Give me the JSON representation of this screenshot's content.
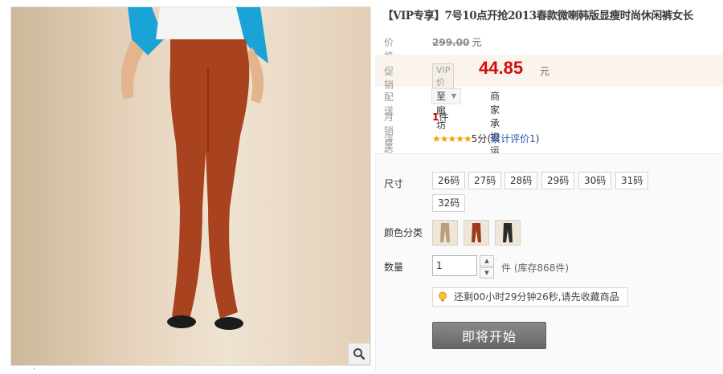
{
  "product": {
    "title": "【VIP专享】7号10点开抢2013春款微喇韩版显瘦时尚休闲裤女长"
  },
  "price": {
    "label": "价格",
    "original": "299.00",
    "unit": "元"
  },
  "promo": {
    "label": "促销",
    "tag": "VIP价格",
    "price": "44.85",
    "unit": "元"
  },
  "shipping": {
    "label": "配送",
    "region": "至 廊坊",
    "note": "商家承担运费"
  },
  "sales": {
    "label": "月销量",
    "count": "1",
    "unit": "件"
  },
  "rating": {
    "label": "评价",
    "stars": "★★★★★",
    "score": "5分",
    "open_paren": "(",
    "link": "累计评价1",
    "close_paren": ")"
  },
  "options": {
    "size_label": "尺寸",
    "sizes": [
      "26码",
      "27码",
      "28码",
      "29码",
      "30码",
      "31码",
      "32码"
    ],
    "color_label": "颜色分类",
    "colors": [
      {
        "name": "khaki",
        "hex": "#b8a07a"
      },
      {
        "name": "rust",
        "hex": "#9c3a1e"
      },
      {
        "name": "black",
        "hex": "#2a2a2a"
      }
    ],
    "qty_label": "数量",
    "qty_value": "1",
    "stock_text": "件 (库存868件)",
    "countdown": "还剩00小时29分钟26秒,请先收藏商品",
    "start_button": "即将开始"
  },
  "gallery": {
    "pants_color": "#a9421f",
    "background_color": "#e8d6bf",
    "bottom_text": "·"
  }
}
